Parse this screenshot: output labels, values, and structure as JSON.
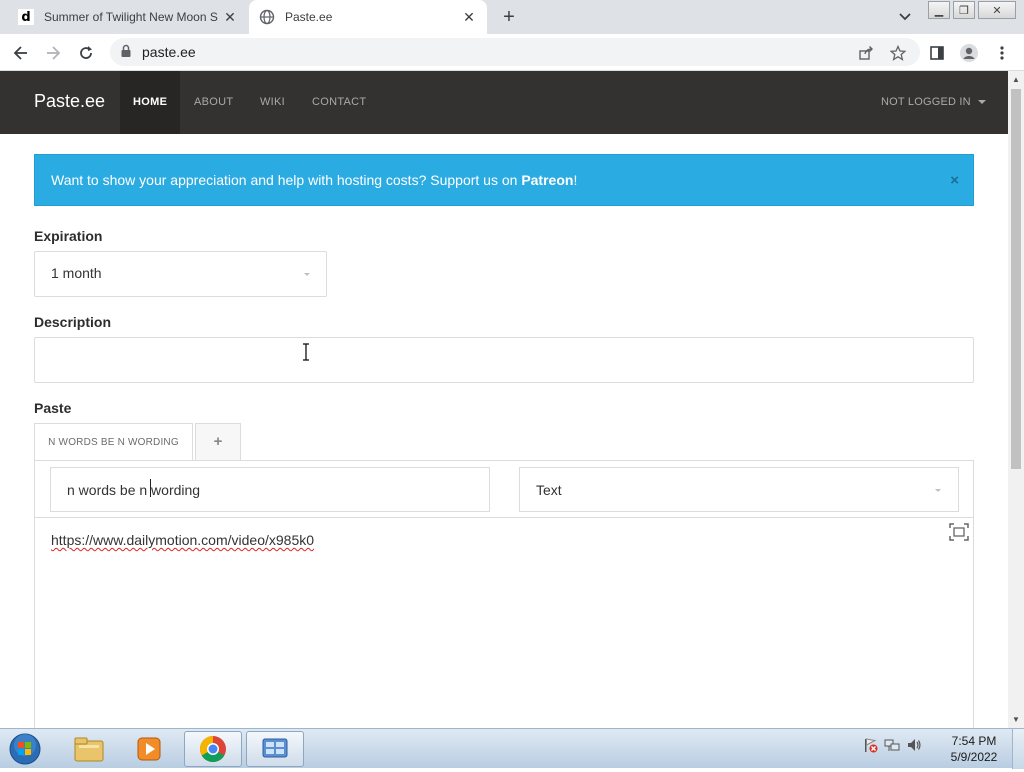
{
  "browser": {
    "tabs": [
      {
        "title": "Summer of Twilight New Moon S",
        "favicon": "dailymotion-d-icon",
        "active": false
      },
      {
        "title": "Paste.ee",
        "favicon": "globe-icon",
        "active": true
      }
    ],
    "url": "paste.ee"
  },
  "site": {
    "brand": "Paste.ee",
    "nav": [
      "HOME",
      "ABOUT",
      "WIKI",
      "CONTACT"
    ],
    "active_nav": "HOME",
    "account_menu": "NOT LOGGED IN",
    "alert": {
      "text": "Want to show your appreciation and help with hosting costs? Support us on ",
      "link": "Patreon",
      "suffix": "!",
      "close": "×",
      "color": "#2aabe2"
    },
    "expiration": {
      "label": "Expiration",
      "value": "1 month"
    },
    "description": {
      "label": "Description",
      "value": ""
    },
    "paste": {
      "label": "Paste",
      "tab_title": "N WORDS BE N WORDING",
      "add_tab": "+",
      "name_value": "n words be n wording",
      "syntax_value": "Text",
      "content": "https://www.dailymotion.com/video/x985k0"
    }
  },
  "taskbar": {
    "apps": [
      "explorer-icon",
      "media-player-icon",
      "chrome-icon",
      "control-panel-icon"
    ],
    "clock_time": "7:54 PM",
    "clock_date": "5/9/2022"
  },
  "colors": {
    "navbar": "#333230",
    "alert": "#2aabe2"
  }
}
